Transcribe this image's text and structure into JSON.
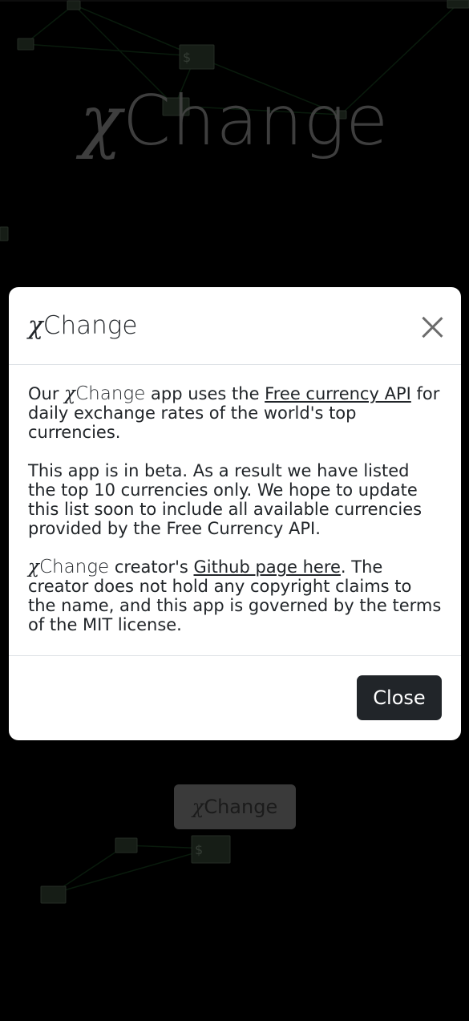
{
  "app": {
    "hero_title_prefix": "χ",
    "hero_title_rest": "Change",
    "bottom_button_prefix": "χ",
    "bottom_button_rest": "Change"
  },
  "modal": {
    "title_prefix": "χ",
    "title_rest": "Change",
    "paragraph1": {
      "before": "Our ",
      "brand_prefix": "χ",
      "brand_rest": "Change",
      "middle": " app uses the ",
      "link": "Free currency API",
      "after": " for daily exchange rates of the world's top currencies."
    },
    "paragraph2": "This app is in beta. As a result we have listed the top 10 currencies only. We hope to update this list soon to include all available currencies provided by the Free Currency API.",
    "paragraph3": {
      "brand_prefix": "χ",
      "brand_rest": "Change",
      "before_link": " creator's ",
      "link": "Github page here",
      "after": ". The creator does not hold any copyright claims to the name, and this app is governed by the terms of the MIT license."
    },
    "close_button": "Close"
  },
  "background_icons": {
    "money": "$"
  },
  "colors": {
    "modal_bg": "#ffffff",
    "close_button_bg": "#212529",
    "hero_text": "#8a8a8a",
    "backdrop": "#000000",
    "network_line": "#1f5a2a"
  }
}
